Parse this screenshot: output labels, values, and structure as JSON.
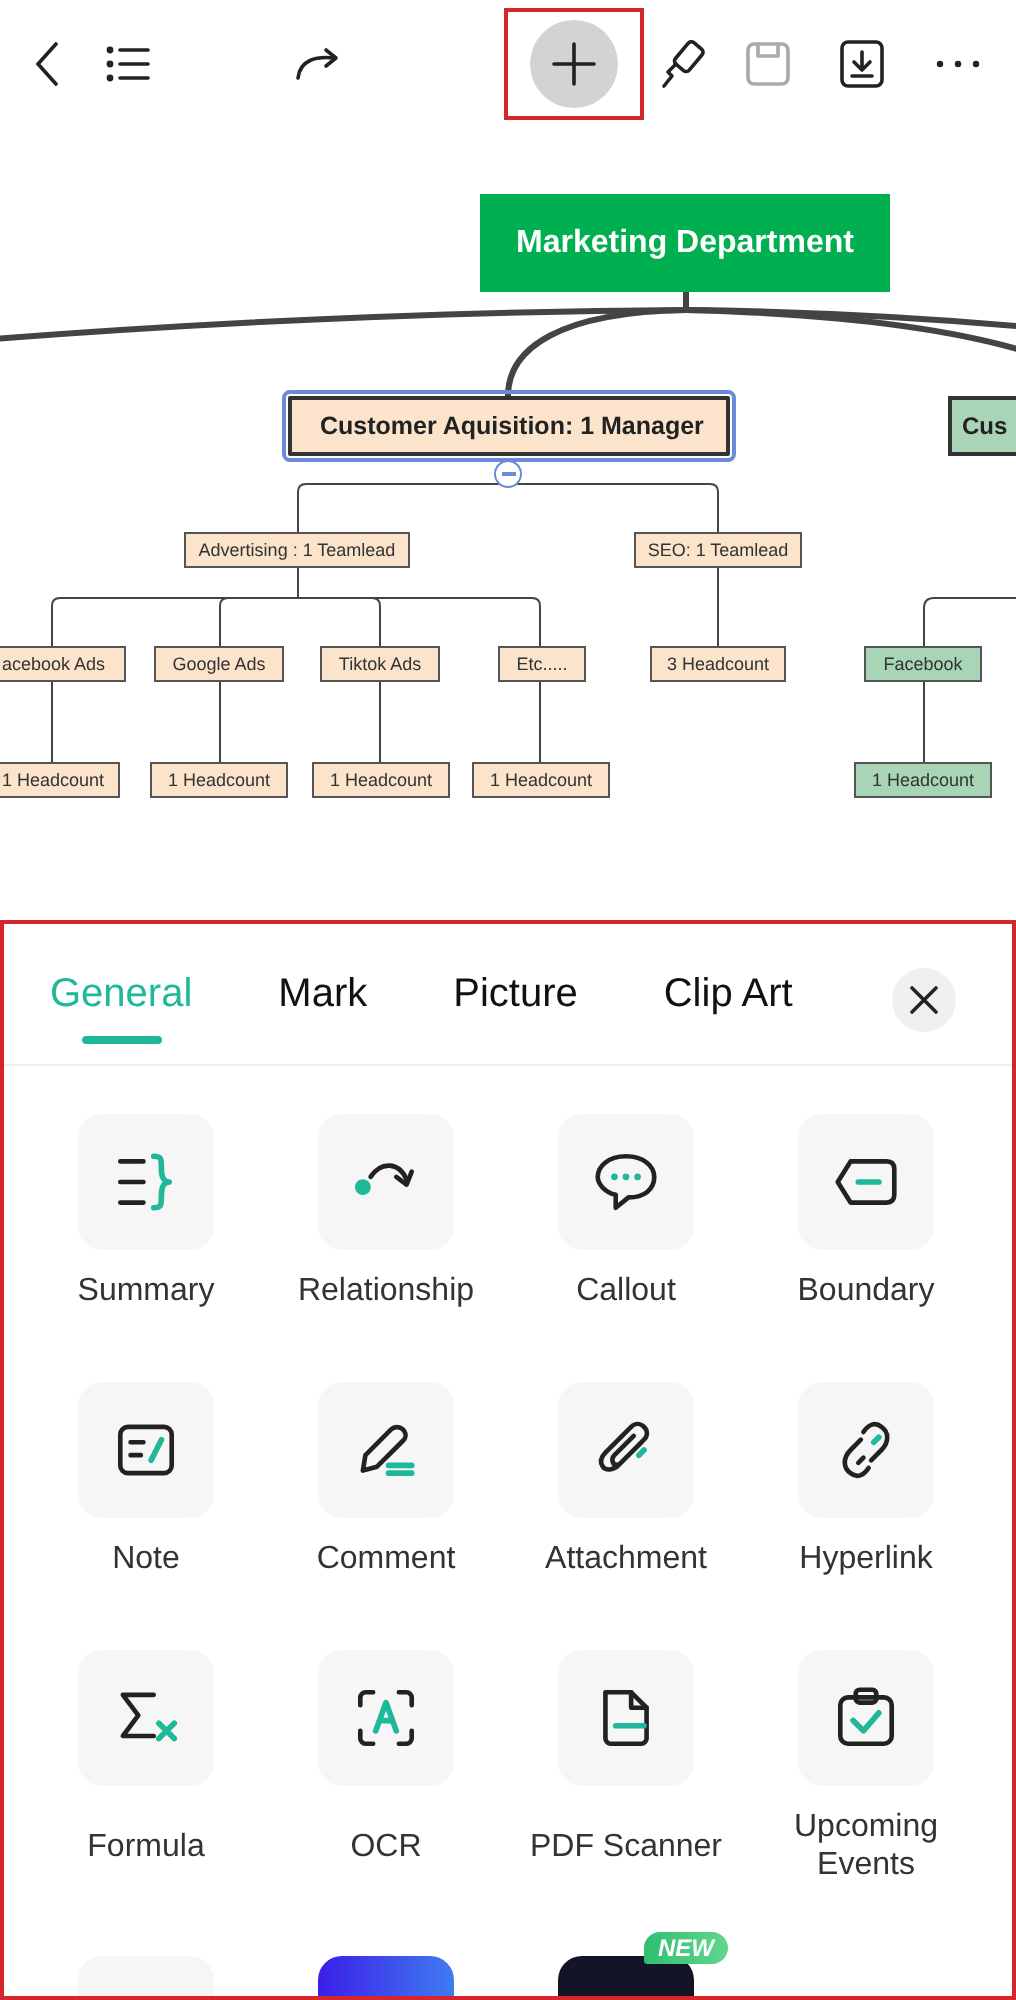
{
  "toolbar": [
    {
      "kind": "back",
      "disabled": false,
      "highlighted": false
    },
    {
      "kind": "outline",
      "disabled": false,
      "highlighted": false
    },
    {
      "kind": "redo",
      "disabled": false,
      "highlighted": false
    },
    {
      "kind": "insert",
      "disabled": false,
      "highlighted": true
    },
    {
      "kind": "style",
      "disabled": false,
      "highlighted": false
    },
    {
      "kind": "save",
      "disabled": true,
      "highlighted": false
    },
    {
      "kind": "export",
      "disabled": false,
      "highlighted": false
    },
    {
      "kind": "more",
      "disabled": false,
      "highlighted": false
    }
  ],
  "mind_map": {
    "text": "Marketing Department",
    "color": "#00b050",
    "selected": false,
    "children": [
      {
        "text": "Customer Aquisition: 1 Manager",
        "color": "#fbe3cc",
        "selected": true,
        "expanded": true,
        "children": [
          {
            "text": "Advertising : 1 Teamlead",
            "color": "#fbe3cc",
            "selected": false,
            "children": [
              {
                "text": "acebook Ads",
                "color": "#fbe3cc",
                "selected": false,
                "children": [
                  {
                    "text": "1 Headcount",
                    "color": "#fbe3cc",
                    "selected": false
                  }
                ]
              },
              {
                "text": "Google Ads",
                "color": "#fbe3cc",
                "selected": false,
                "children": [
                  {
                    "text": "1 Headcount",
                    "color": "#fbe3cc",
                    "selected": false
                  }
                ]
              },
              {
                "text": "Tiktok Ads",
                "color": "#fbe3cc",
                "selected": false,
                "children": [
                  {
                    "text": "1 Headcount",
                    "color": "#fbe3cc",
                    "selected": false
                  }
                ]
              },
              {
                "text": "Etc.....",
                "color": "#fbe3cc",
                "selected": false,
                "children": [
                  {
                    "text": "1 Headcount",
                    "color": "#fbe3cc",
                    "selected": false
                  }
                ]
              }
            ]
          },
          {
            "text": "SEO: 1 Teamlead",
            "color": "#fbe3cc",
            "selected": false,
            "children": [
              {
                "text": "3 Headcount",
                "color": "#fbe3cc",
                "selected": false
              }
            ]
          }
        ]
      },
      {
        "text": "Cus",
        "color": "#a8d5b5",
        "selected": false,
        "children": [
          {
            "text": "Facebook",
            "color": "#a8d5b5",
            "selected": false,
            "children": [
              {
                "text": "1 Headcount",
                "color": "#a8d5b5",
                "selected": false
              }
            ]
          }
        ]
      }
    ]
  },
  "panel": {
    "highlighted": true,
    "tabs": [
      {
        "label": "General",
        "selected": true
      },
      {
        "label": "Mark",
        "selected": false
      },
      {
        "label": "Picture",
        "selected": false
      },
      {
        "label": "Clip Art",
        "selected": false
      }
    ],
    "items": [
      {
        "kind": "tool",
        "label": "Summary"
      },
      {
        "kind": "tool",
        "label": "Relationship"
      },
      {
        "kind": "tool",
        "label": "Callout"
      },
      {
        "kind": "tool",
        "label": "Boundary"
      },
      {
        "kind": "tool",
        "label": "Note"
      },
      {
        "kind": "tool",
        "label": "Comment"
      },
      {
        "kind": "tool",
        "label": "Attachment"
      },
      {
        "kind": "tool",
        "label": "Hyperlink"
      },
      {
        "kind": "tool",
        "label": "Formula"
      },
      {
        "kind": "tool",
        "label": "OCR"
      },
      {
        "kind": "tool",
        "label": "PDF Scanner"
      },
      {
        "kind": "tool",
        "label": "Upcoming Events"
      },
      {
        "kind": "partial"
      },
      {
        "kind": "partial"
      },
      {
        "kind": "partial",
        "badge": "NEW"
      }
    ]
  }
}
